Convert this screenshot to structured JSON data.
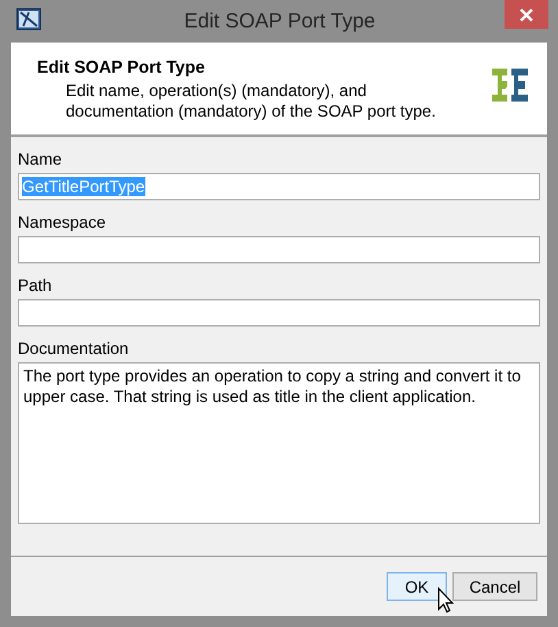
{
  "window": {
    "title": "Edit SOAP Port Type"
  },
  "header": {
    "title": "Edit SOAP Port Type",
    "description": "Edit name, operation(s) (mandatory), and documentation (mandatory) of the SOAP port type."
  },
  "fields": [
    {
      "kind": "line",
      "label": "Name",
      "value": "GetTitlePortType",
      "text_selected": true
    },
    {
      "kind": "line",
      "label": "Namespace"
    },
    {
      "kind": "line",
      "label": "Path"
    },
    {
      "kind": "area",
      "label": "Documentation",
      "value": "The port type provides an operation to copy a string and convert it to upper case. That string is used as title in the client application.",
      "text_selected": false
    }
  ],
  "buttons": [
    {
      "label": "OK",
      "hovered": true
    },
    {
      "label": "Cancel",
      "hovered": false
    }
  ]
}
